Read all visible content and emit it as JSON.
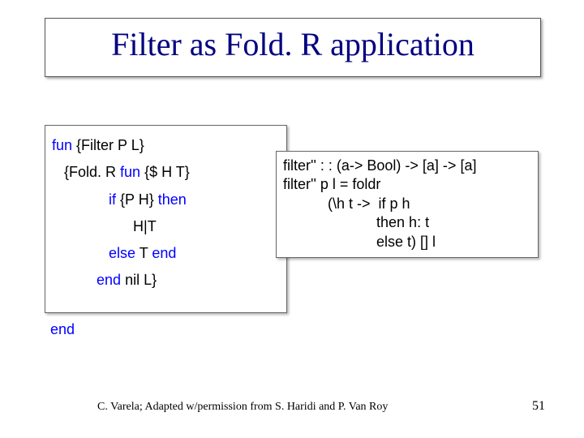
{
  "title": "Filter as Fold. R application",
  "left": {
    "l1_kw": "fun",
    "l1_rest": " {Filter P L}",
    "l2_pre": "   {Fold. R ",
    "l2_kw": "fun",
    "l2_rest": " {$ H T}",
    "l3_pre": "              ",
    "l3_kw": "if",
    "l3_mid": " {P H} ",
    "l3_kw2": "then",
    "l4": "                    H|T",
    "l5_pre": "              ",
    "l5_kw": "else",
    "l5_mid": " T ",
    "l5_kw2": "end",
    "l6_pre": "           ",
    "l6_kw": "end",
    "l6_rest": " nil L}",
    "end_kw": "end"
  },
  "right": {
    "l1": "filter'' : : (a-> Bool) -> [a] -> [a]",
    "l2": "filter'' p l = foldr",
    "l3": "           (\\h t ->  if p h",
    "l4": "                       then h: t",
    "l5": "                       else t) [] l"
  },
  "footer": {
    "credit": "C. Varela; Adapted w/permission from S. Haridi and P. Van Roy",
    "page": "51"
  }
}
